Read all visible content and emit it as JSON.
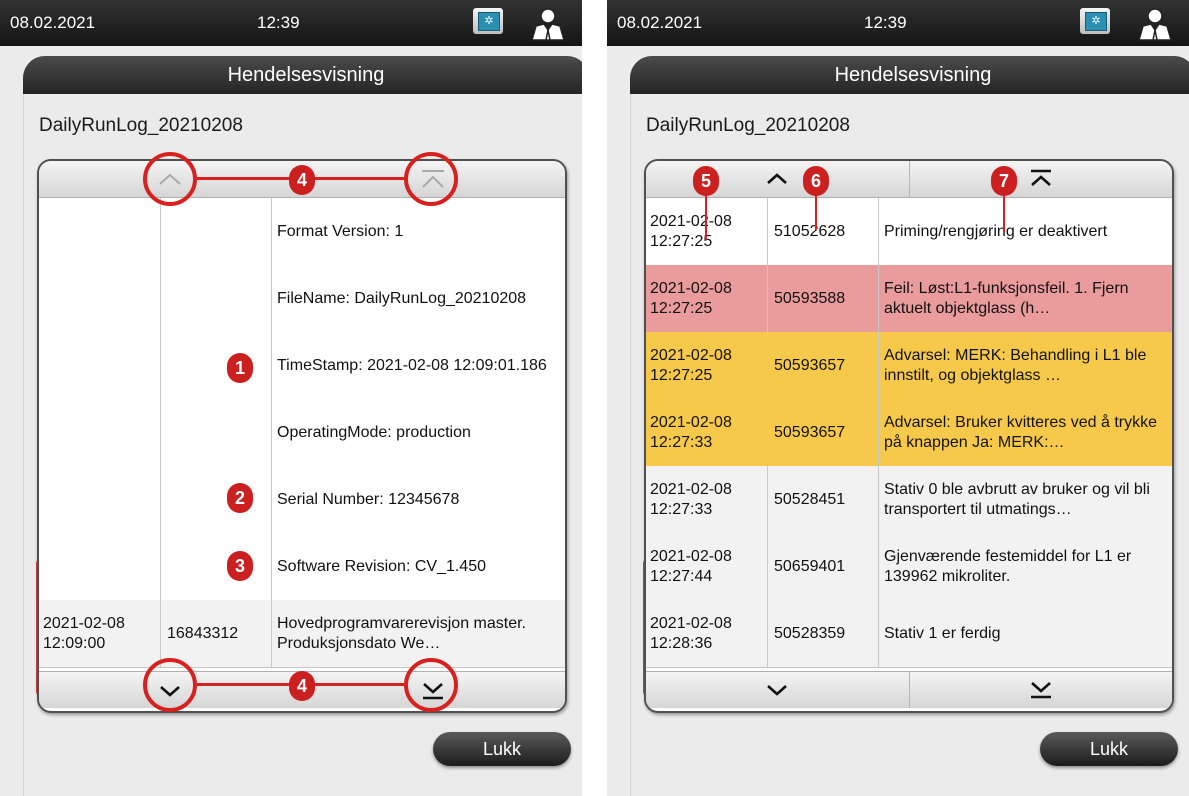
{
  "screens": [
    {
      "status": {
        "date": "08.02.2021",
        "time": "12:39",
        "device_glyph": "✲"
      },
      "title": "Hendelsesvisning",
      "file": "DailyRunLog_20210208",
      "rows": [
        {
          "date": "",
          "code": "",
          "text": "Format Version: 1",
          "style": "white"
        },
        {
          "date": "",
          "code": "",
          "text": "FileName: DailyRunLog_20210208",
          "style": "white"
        },
        {
          "date": "",
          "code": "",
          "text": "TimeStamp: 2021-02-08 12:09:01.186",
          "style": "white"
        },
        {
          "date": "",
          "code": "",
          "text": "OperatingMode: production",
          "style": "white"
        },
        {
          "date": "",
          "code": "",
          "text": "Serial Number: 12345678",
          "style": "white"
        },
        {
          "date": "",
          "code": "",
          "text": "Software Revision: CV_1.450",
          "style": "white"
        },
        {
          "date": "2021-02-08 12:09:00",
          "code": "16843312",
          "text": "Hovedprogramvarerevisjon master. Produksjonsdato We…",
          "style": "plain"
        }
      ],
      "close_label": "Lukk",
      "callouts": {
        "c1": "1",
        "c2": "2",
        "c3": "3",
        "c4a": "4",
        "c4b": "4"
      }
    },
    {
      "status": {
        "date": "08.02.2021",
        "time": "12:39",
        "device_glyph": "✲"
      },
      "title": "Hendelsesvisning",
      "file": "DailyRunLog_20210208",
      "rows": [
        {
          "date": "2021-02-08 12:27:25",
          "code": "51052628",
          "text": "Priming/rengjøring er deaktivert",
          "style": "white"
        },
        {
          "date": "2021-02-08 12:27:25",
          "code": "50593588",
          "text": "Feil: Løst:L1-funksjonsfeil. 1. Fjern aktuelt objektglass (h…",
          "style": "red"
        },
        {
          "date": "2021-02-08 12:27:25",
          "code": "50593657",
          "text": "Advarsel: MERK: Behandling i L1 ble innstilt, og objektglass …",
          "style": "yellow"
        },
        {
          "date": "2021-02-08 12:27:33",
          "code": "50593657",
          "text": "Advarsel: Bruker kvitteres ved å trykke på knappen Ja: MERK:…",
          "style": "yellow"
        },
        {
          "date": "2021-02-08 12:27:33",
          "code": "50528451",
          "text": "Stativ 0 ble avbrutt av bruker og vil bli transportert til utmatings…",
          "style": "plain"
        },
        {
          "date": "2021-02-08 12:27:44",
          "code": "50659401",
          "text": "Gjenværende festemiddel for L1 er 139962 mikroliter.",
          "style": "plain"
        },
        {
          "date": "2021-02-08 12:28:36",
          "code": "50528359",
          "text": "Stativ 1 er ferdig",
          "style": "plain"
        }
      ],
      "close_label": "Lukk",
      "callouts": {
        "c5": "5",
        "c6": "6",
        "c7": "7"
      }
    }
  ],
  "icons": {
    "scroll_up": "chevron-up-icon",
    "scroll_top": "double-chevron-top-icon",
    "scroll_down": "chevron-down-icon",
    "scroll_bottom": "chevron-bottom-icon",
    "user": "user-icon",
    "device": "instrument-status-icon"
  },
  "colors": {
    "error_row": "#ea9c9c",
    "warning_row": "#f7c94a",
    "callout": "#d8201f"
  }
}
